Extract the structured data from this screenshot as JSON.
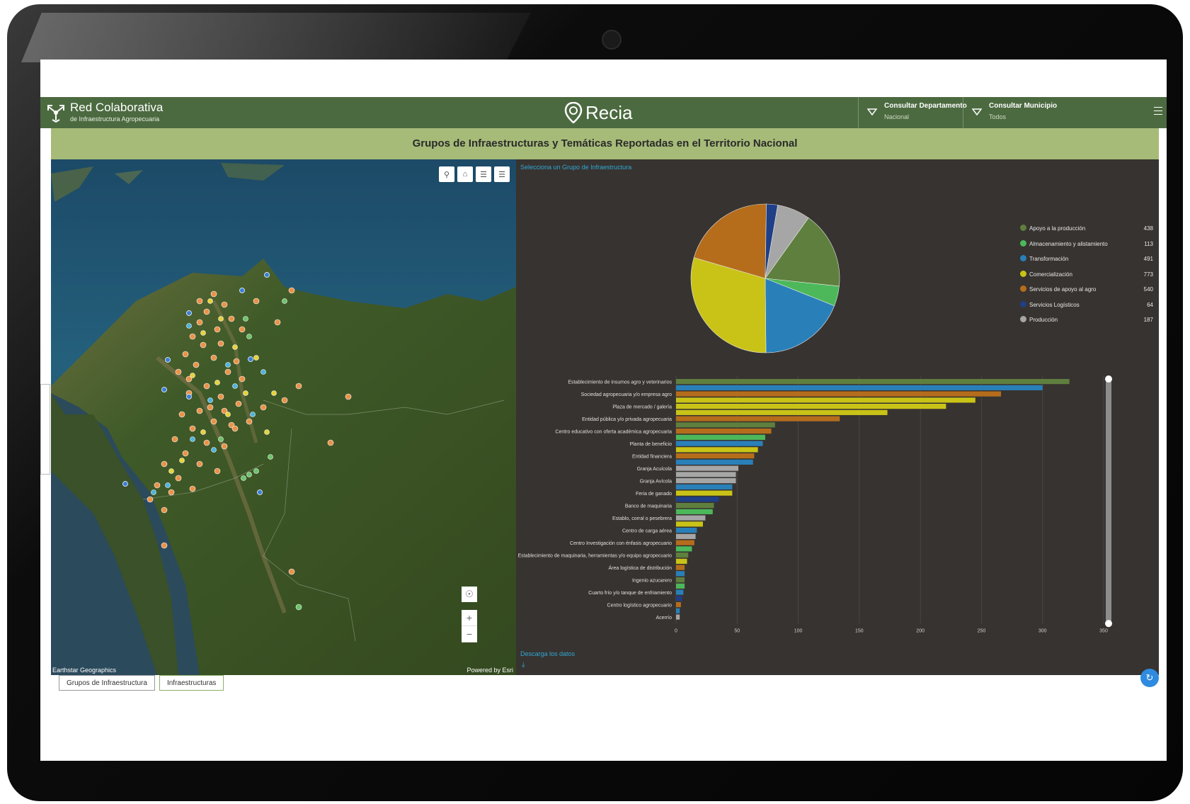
{
  "app": {
    "brand_title": "Red Colaborativa",
    "brand_subtitle": "de Infraestructura Agropecuaria",
    "logo_text": "Recia",
    "accent_color": "#4c6a40",
    "band_color": "#a6bb78"
  },
  "filters": {
    "departamento": {
      "label": "Consultar Departamento",
      "value": "Nacional"
    },
    "municipio": {
      "label": "Consultar Municipio",
      "value": "Todos"
    }
  },
  "page_title": "Grupos de Infraestructuras y Temáticas Reportadas en el Territorio Nacional",
  "map": {
    "attribution_left": "Earthstar Geographics",
    "attribution_right": "Powered by Esri",
    "tools": [
      "search-icon",
      "home-icon",
      "list-icon",
      "layers-icon"
    ],
    "zoom_in": "+",
    "zoom_out": "−"
  },
  "panel": {
    "select_label": "Selecciona un Grupo de Infraestructura",
    "download_label": "Descarga los datos"
  },
  "tabs": [
    "Grupos de Infraestructura",
    "Infraestructuras"
  ],
  "chart_data": [
    {
      "type": "pie",
      "categories": [
        "Apoyo a la producción",
        "Almacenamiento y alistamiento",
        "Transformación",
        "Comercialización",
        "Servicios de apoyo al agro",
        "Servicios Logísticos",
        "Producción"
      ],
      "values": [
        438,
        113,
        491,
        773,
        540,
        64,
        187
      ],
      "colors": [
        "#5f7f3e",
        "#4cb85a",
        "#2980b9",
        "#c9c317",
        "#b56d1c",
        "#1f3f86",
        "#a6a6a6"
      ],
      "legend": "right"
    },
    {
      "type": "bar",
      "orientation": "horizontal",
      "categories": [
        "Establecimiento de insumos agro y veterinarios",
        "Sociedad agropecuaria y/o empresa agro",
        "Plaza de mercado / galería",
        "Entidad pública y/o privada agropecuaria",
        "Centro educativo con oferta académica agropecuaria",
        "Planta de beneficio",
        "Entidad financiera",
        "Granja Acuícola",
        "Granja Avícola",
        "Feria de ganado",
        "Banco de maquinaria",
        "Establo, corral o pesebrera",
        "Centro de carga aérea",
        "Centro Investigación con énfasis agropecuario",
        "Establecimiento de maquinaria, herramientas y/o equipo agropecuario",
        "Área logística de distribución",
        "Ingenio azucarero",
        "Cuarto frío y/o tanque de enfriamiento",
        "Centro logístico agropecuario",
        "Acerrío"
      ],
      "x_ticks": [
        0,
        50,
        100,
        150,
        200,
        250,
        300,
        350
      ],
      "xlim": [
        0,
        350
      ],
      "bars": [
        {
          "c": "#5f7f3e",
          "v": 322
        },
        {
          "c": "#2980b9",
          "v": 300
        },
        {
          "c": "#b56d1c",
          "v": 266
        },
        {
          "c": "#c9c317",
          "v": 245
        },
        {
          "c": "#c9c317",
          "v": 221
        },
        {
          "c": "#c9c317",
          "v": 173
        },
        {
          "c": "#b56d1c",
          "v": 134
        },
        {
          "c": "#5f7f3e",
          "v": 81
        },
        {
          "c": "#b56d1c",
          "v": 78
        },
        {
          "c": "#4cb85a",
          "v": 73
        },
        {
          "c": "#2980b9",
          "v": 71
        },
        {
          "c": "#c9c317",
          "v": 67
        },
        {
          "c": "#b56d1c",
          "v": 64
        },
        {
          "c": "#2980b9",
          "v": 63
        },
        {
          "c": "#a6a6a6",
          "v": 51
        },
        {
          "c": "#a6a6a6",
          "v": 49
        },
        {
          "c": "#a6a6a6",
          "v": 49
        },
        {
          "c": "#2980b9",
          "v": 46
        },
        {
          "c": "#c9c317",
          "v": 46
        },
        {
          "c": "#1f3f86",
          "v": 35
        },
        {
          "c": "#5f7f3e",
          "v": 31
        },
        {
          "c": "#4cb85a",
          "v": 30
        },
        {
          "c": "#a6a6a6",
          "v": 24
        },
        {
          "c": "#c9c317",
          "v": 22
        },
        {
          "c": "#2980b9",
          "v": 17
        },
        {
          "c": "#a6a6a6",
          "v": 16
        },
        {
          "c": "#b56d1c",
          "v": 15
        },
        {
          "c": "#4cb85a",
          "v": 13
        },
        {
          "c": "#5f7f3e",
          "v": 10
        },
        {
          "c": "#c9c317",
          "v": 9
        },
        {
          "c": "#b56d1c",
          "v": 7
        },
        {
          "c": "#2980b9",
          "v": 7
        },
        {
          "c": "#5f7f3e",
          "v": 7
        },
        {
          "c": "#4cb85a",
          "v": 7
        },
        {
          "c": "#2980b9",
          "v": 6
        },
        {
          "c": "#1f3f86",
          "v": 5
        },
        {
          "c": "#b56d1c",
          "v": 4
        },
        {
          "c": "#2980b9",
          "v": 3
        },
        {
          "c": "#a6a6a6",
          "v": 3
        }
      ]
    }
  ]
}
